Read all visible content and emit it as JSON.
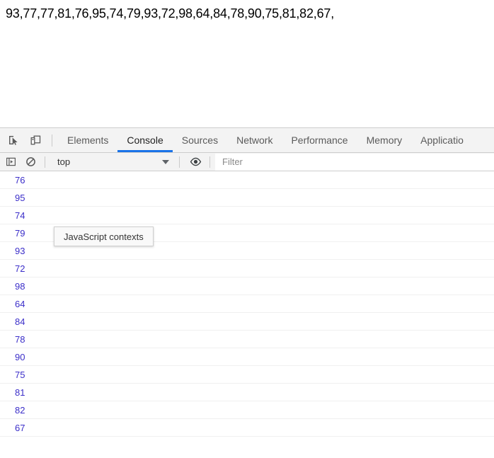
{
  "page": {
    "content_text": "93,77,77,81,76,95,74,79,93,72,98,64,84,78,90,75,81,82,67,"
  },
  "devtools": {
    "toolbar_icons": [
      {
        "name": "inspect-element-icon",
        "title": "Inspect element"
      },
      {
        "name": "device-toolbar-icon",
        "title": "Toggle device toolbar"
      }
    ],
    "tabs": [
      {
        "label": "Elements",
        "active": false
      },
      {
        "label": "Console",
        "active": true
      },
      {
        "label": "Sources",
        "active": false
      },
      {
        "label": "Network",
        "active": false
      },
      {
        "label": "Performance",
        "active": false
      },
      {
        "label": "Memory",
        "active": false
      },
      {
        "label": "Applicatio",
        "active": false
      }
    ],
    "console_toolbar": {
      "sidebar_toggle_icon": "sidebar-toggle-icon",
      "clear_console_icon": "clear-console-icon",
      "context_selected": "top",
      "context_dropdown_icon": "chevron-down-icon",
      "eye_icon": "eye-icon",
      "filter_placeholder": "Filter"
    },
    "tooltip": {
      "text": "JavaScript contexts"
    },
    "console_rows": [
      {
        "value": "76"
      },
      {
        "value": "95"
      },
      {
        "value": "74"
      },
      {
        "value": "79"
      },
      {
        "value": "93"
      },
      {
        "value": "72"
      },
      {
        "value": "98"
      },
      {
        "value": "64"
      },
      {
        "value": "84"
      },
      {
        "value": "78"
      },
      {
        "value": "90"
      },
      {
        "value": "75"
      },
      {
        "value": "81"
      },
      {
        "value": "82"
      },
      {
        "value": "67"
      }
    ]
  },
  "colors": {
    "accent": "#1a73e8",
    "console_number": "#3b2ec9",
    "toolbar_bg": "#f3f3f3",
    "border": "#cdcdcd"
  }
}
